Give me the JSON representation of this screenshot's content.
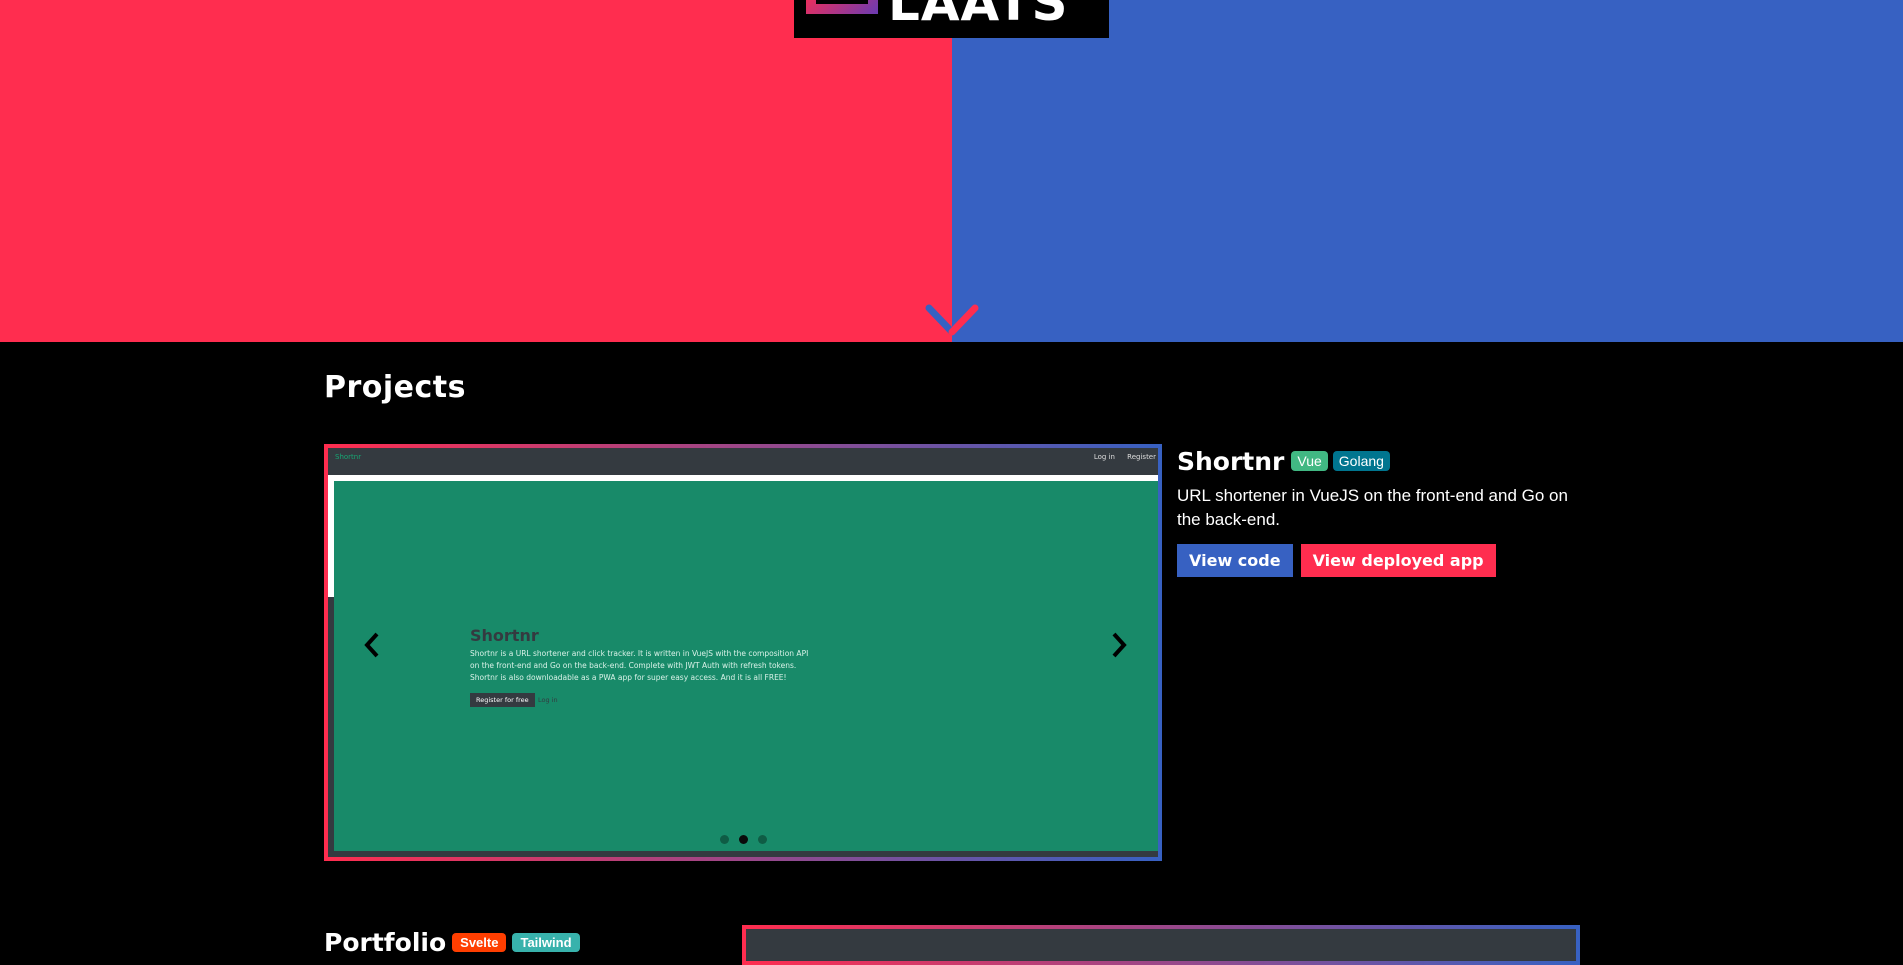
{
  "hero": {
    "logo_text": "LAATS",
    "colors": {
      "left": "#ff2d4f",
      "right": "#3761c2"
    },
    "scroll_icon": "chevron-down-icon"
  },
  "projects": {
    "section_title": "Projects",
    "items": [
      {
        "title": "Shortnr",
        "tags": [
          "Vue",
          "Golang"
        ],
        "description": "URL shortener in VueJS on the front-end and Go on the back-end.",
        "buttons": {
          "code": "View code",
          "app": "View deployed app"
        },
        "screenshot": {
          "brand": "Shortnr",
          "nav_links": [
            "Log in",
            "Register"
          ],
          "heading": "Shortnr",
          "text": "Shortnr is a URL shortener and click tracker. It is written in VueJS with the composition API on the front-end and Go on the back-end. Complete with JWT Auth with refresh tokens. Shortnr is also downloadable as a PWA app for super easy access. And it is all FREE!",
          "register_button": "Register for free",
          "login_link": "Log in"
        },
        "carousel": {
          "slide_count": 3,
          "active_index": 1
        }
      },
      {
        "title": "Portfolio",
        "tags": [
          "Svelte",
          "Tailwind"
        ]
      }
    ]
  }
}
